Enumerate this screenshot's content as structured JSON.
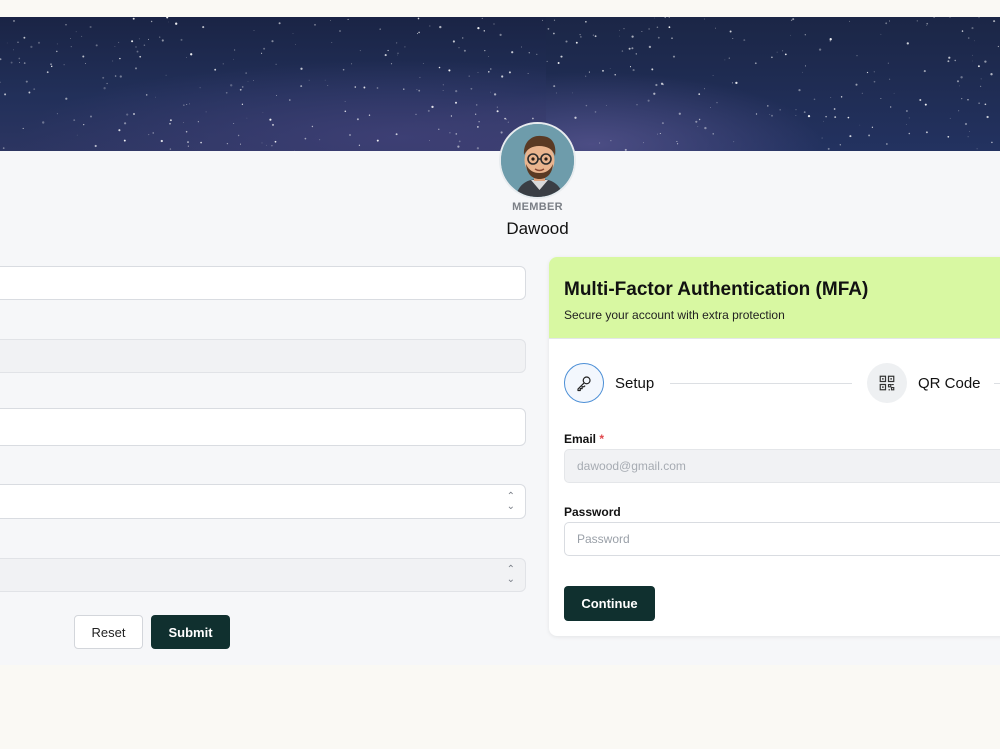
{
  "profile": {
    "role": "MEMBER",
    "name": "Dawood"
  },
  "form": {
    "reset_label": "Reset",
    "submit_label": "Submit"
  },
  "mfa": {
    "title": "Multi-Factor Authentication (MFA)",
    "subtitle": "Secure your account with extra protection",
    "steps": [
      {
        "label": "Setup",
        "icon": "key-icon"
      },
      {
        "label": "QR Code",
        "icon": "qr-code-icon"
      }
    ],
    "email_label": "Email",
    "email_required_mark": "*",
    "email_value": "dawood@gmail.com",
    "password_label": "Password",
    "password_placeholder": "Password",
    "continue_label": "Continue"
  },
  "colors": {
    "accent_dark": "#10302f",
    "mfa_header": "#d8f8a2",
    "step_active": "#4c8fd6"
  }
}
